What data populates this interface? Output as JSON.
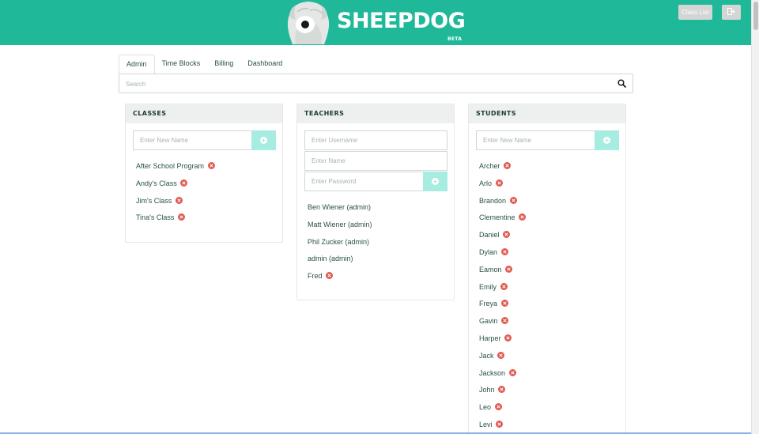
{
  "header": {
    "brand": "SHEEPDOG",
    "badge": "BETA",
    "class_list_label": "Class List",
    "logout_icon": "logout-icon",
    "accent_color": "#1fb99a"
  },
  "tabs": [
    {
      "label": "Admin",
      "active": true
    },
    {
      "label": "Time Blocks",
      "active": false
    },
    {
      "label": "Billing",
      "active": false
    },
    {
      "label": "Dashboard",
      "active": false
    }
  ],
  "search": {
    "placeholder": "Search",
    "icon": "search-icon"
  },
  "classes": {
    "title": "CLASSES",
    "new_placeholder": "Enter New Name",
    "items": [
      "After School Program",
      "Andy's Class",
      "Jim's Class",
      "Tina's Class"
    ]
  },
  "teachers": {
    "title": "TEACHERS",
    "username_placeholder": "Enter Username",
    "name_placeholder": "Enter Name",
    "password_placeholder": "Enter Password",
    "items": [
      {
        "name": "Ben Wiener (admin)",
        "removable": false
      },
      {
        "name": "Matt Wiener (admin)",
        "removable": false
      },
      {
        "name": "Phil Zucker (admin)",
        "removable": false
      },
      {
        "name": "admin (admin)",
        "removable": false
      },
      {
        "name": "Fred",
        "removable": true
      }
    ]
  },
  "students": {
    "title": "STUDENTS",
    "new_placeholder": "Enter New Name",
    "items": [
      "Archer",
      "Arlo",
      "Brandon",
      "Clementine",
      "Daniel",
      "Dylan",
      "Eamon",
      "Emily",
      "Freya",
      "Gavin",
      "Harper",
      "Jack",
      "Jackson",
      "John",
      "Leo",
      "Levi"
    ]
  },
  "colors": {
    "remove": "#e05a4e",
    "add_button": "#a7ece0"
  }
}
